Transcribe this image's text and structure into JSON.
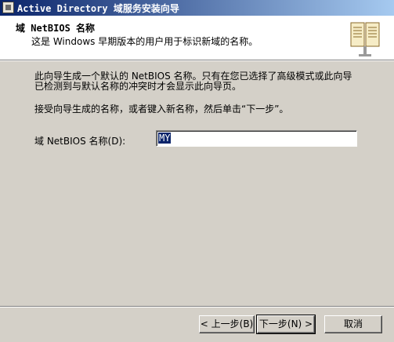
{
  "window": {
    "title": "Active Directory 域服务安装向导",
    "icon": "server-icon"
  },
  "header": {
    "title": "域 NetBIOS 名称",
    "subtitle": "这是 Windows 早期版本的用户用于标识新域的名称。",
    "icon": "book-icon"
  },
  "body": {
    "paragraph1_line1": "此向导生成一个默认的 NetBIOS 名称。只有在您已选择了高级模式或此向导",
    "paragraph1_line2": "已检测到与默认名称的冲突时才会显示此向导页。",
    "paragraph2": "接受向导生成的名称，或者键入新名称，然后单击“下一步”。"
  },
  "field": {
    "label": "域 NetBIOS 名称(D):",
    "value": "MY"
  },
  "buttons": {
    "back": "< 上一步(B)",
    "next": "下一步(N) >",
    "cancel": "取消"
  }
}
